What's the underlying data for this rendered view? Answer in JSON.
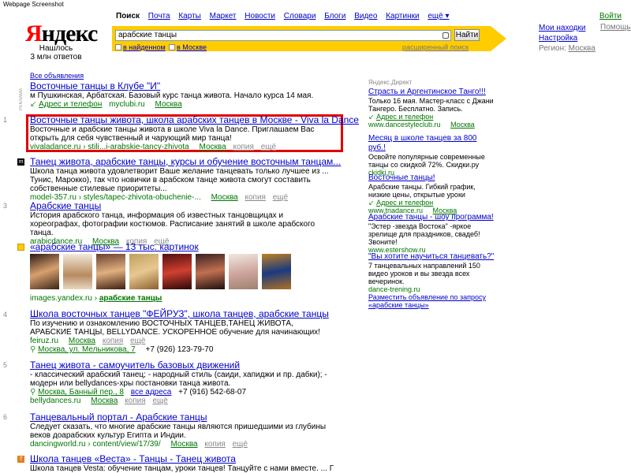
{
  "watermark": "Webpage Screenshot",
  "header": {
    "logo": "Яндекс",
    "found_line1": "Нашлось",
    "found_line2": "3 млн ответов",
    "tabs": [
      "Поиск",
      "Почта",
      "Карты",
      "Маркет",
      "Новости",
      "Словари",
      "Блоги",
      "Видео",
      "Картинки",
      "ещё ▾"
    ],
    "search_value": "арабские танцы",
    "find_button": "Найти",
    "chk_found": "в найденном",
    "chk_moscow": "в Москве",
    "advanced": "расширенный поиск",
    "login": "Войти",
    "my_finds": "Мои находки",
    "help": "Помощь",
    "settings": "Настройка",
    "region_label": "Регион:",
    "region_value": "Москва"
  },
  "left": {
    "all_ads": "Все объявления",
    "reklama": "РЕКЛАМА",
    "ad1": {
      "title": "Восточные танцы в Клубе \"И\"",
      "snippet": "м Пушкинская, Арбатская. Базовый курс танца живота. Начало курса 14 мая.",
      "contacts": "Адрес и телефон",
      "url": "myclubi.ru",
      "city": "Москва"
    },
    "results": [
      {
        "num": "1",
        "title": "Восточные танцы живота, школа арабских танцев в Москве - Viva la Dance",
        "snippet": "Восточные и арабские танцы живота в школе Viva la Dance. Приглашаем Вас открыть для себя чувственный и чарующий мир танца!",
        "url": "vivaladance.ru › stili...i-arabskie-tancy-zhivota",
        "city": "Москва",
        "copy": "копия",
        "more": "ещё"
      },
      {
        "num": "2",
        "title": "Танец живота, арабские танцы, курсы и обучение восточным танцам...",
        "snippet": "Школа танца живота удовлетворит Ваше желание танцевать только лучшее из ... Тунис, Марокко), так что новички в арабском танце живота смогут составить собственные стилевые приоритеты...",
        "url": "model-357.ru › styles/tapec-zhivota-obuchenie-...",
        "city": "Москва",
        "copy": "копия",
        "more": "ещё"
      },
      {
        "num": "3",
        "title": "Арабские танцы",
        "snippet": "История арабского танца, информация об известных танцовщицах и хореографах, фотографии костюмов. Расписание занятий в школе арабского танца.",
        "url": "arabicdance.ru",
        "city": "Москва",
        "copy": "копия",
        "more": "ещё"
      }
    ],
    "images": {
      "title": "«арабские танцы» — 13 тыс. картинок",
      "url": "images.yandex.ru",
      "query": "арабские танцы"
    },
    "results2": [
      {
        "num": "4",
        "title": "Школа восточных танцев \"ФЕЙРУЗ\", школа танцев, арабские танцы",
        "snippet": "По изучению и ознакомлению ВОСТОЧНЫХ ТАНЦЕВ,ТАНЕЦ ЖИВОТА, АРАБСКИЕ ТАНЦЫ, BELLYDANCE. УСКОРЕННОЕ обучение для начинающих!",
        "url": "feiruz.ru",
        "phone_line": "+7 (926) 123-79-70",
        "address": "Москва, ул. Мельникова, 7",
        "city": "Москва",
        "copy": "копия",
        "more": "ещё"
      },
      {
        "num": "5",
        "title": "Танец живота - самоучитель базовых движений",
        "snippet": "- классический арабский танец; - народный стиль (саиди, хапиджи и пр. дабки); - модерн или bellydances-хры постановки танца живота.",
        "url": "bellydances.ru",
        "address": "Москва, Банный пер., 8",
        "all_addr": "все адреса",
        "phone": "+7 (916) 542-68-07",
        "city": "Москва",
        "copy": "копия",
        "more": "ещё"
      },
      {
        "num": "6",
        "title": "Танцевальный портал - Арабские танцы",
        "snippet": "Следует сказать, что многие арабские танцы являются пришедшими из глубины веков доарабских культур Египта и Индии.",
        "url": "dancingworld.ru › content/view/17/39/",
        "city": "Москва",
        "copy": "копия",
        "more": "ещё"
      },
      {
        "num": "7",
        "title": "Школа танцев «Веста» - Танцы - Танец живота",
        "snippet": "Школа танцев Vesta: обучение танцам, уроки танцев! Танцуйте с нами вместе. ... По этом его часто"
      }
    ]
  },
  "right": {
    "direct": "Яндекс.Директ",
    "ads": [
      {
        "title": "Страсть и Аргентинское Танго!!!",
        "text": "Только 16 мая. Мастер-класс с Джани Тангеро. Бесплатно. Запись.",
        "contacts": "Адрес и телефон",
        "url": "www.dancestyleclub.ru",
        "city": "Москва"
      },
      {
        "title": "Месяц в школе танцев за 800 руб.!",
        "text": "Освойте популярные современные танцы со скидкой 72%. Скидки.ру",
        "url": "ckidki.ru"
      },
      {
        "title": "Восточные танцы!",
        "text": "Арабские танцы. Гибкий график, низкие цены, открытые уроки",
        "contacts": "Адрес и телефон",
        "url": "www.triadance.ru",
        "city": "Москва"
      },
      {
        "title": "Арабские танцы - шоу программа!",
        "text": "\"Эстер -звезда Востока\" -яркое зрелище для праздников, свадеб! Звоните!",
        "url": "www.estershow.ru"
      },
      {
        "title": "\"Вы хотите научиться танцевать?\"",
        "text": "7 танцевальных направлений 150 видео уроков и вы звезда всех вечеринок.",
        "url": "dance-trening.ru"
      }
    ],
    "place_ad": "Разместить объявление по запросу «арабские танцы»"
  }
}
